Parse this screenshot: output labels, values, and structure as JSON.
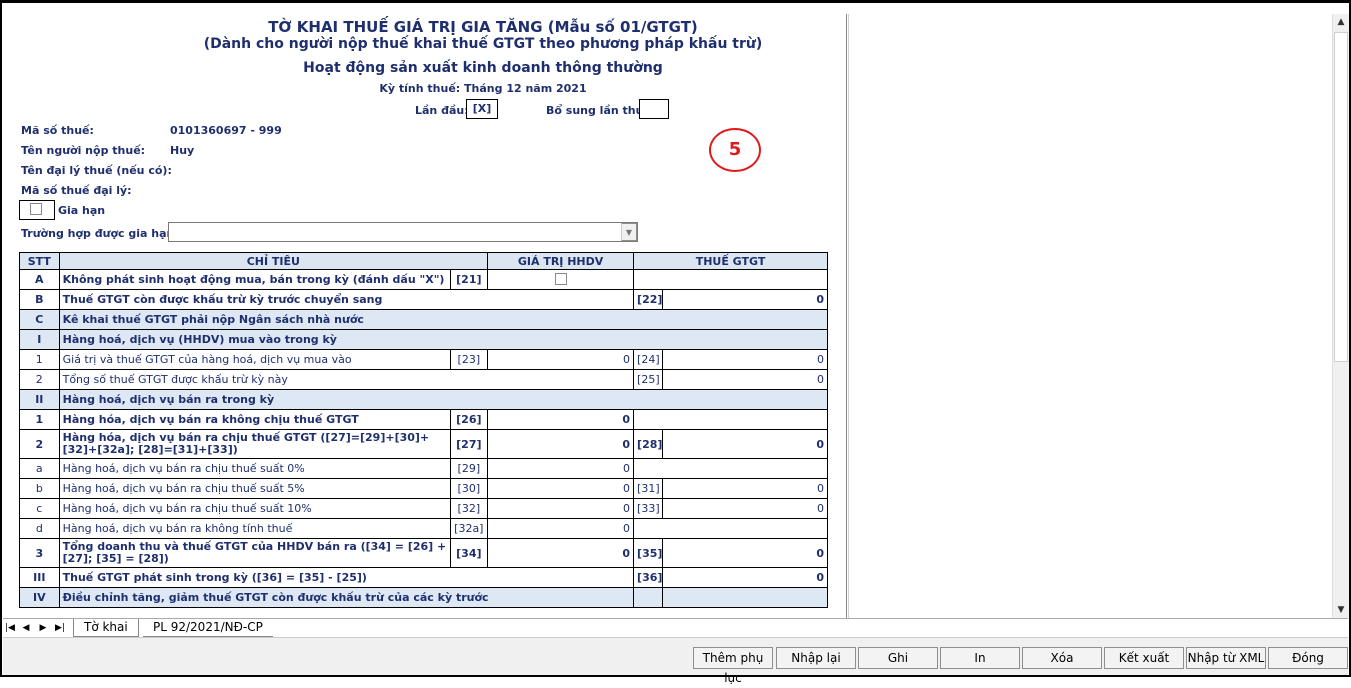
{
  "header": {
    "title": "TỜ KHAI THUẾ GIÁ TRỊ GIA TĂNG (Mẫu số 01/GTGT)",
    "subtitle": "(Dành cho người nộp thuế khai thuế GTGT theo phương pháp khấu trừ)",
    "activity": "Hoạt động sản xuất kinh doanh thông thường",
    "period": "Kỳ tính thuế: Tháng 12 năm 2021",
    "first_time_label": "Lần đầu:",
    "first_time_value": "[X]",
    "supplement_label": "Bổ sung lần thứ:",
    "supplement_value": ""
  },
  "taxpayer": {
    "tax_id_label": "Mã số thuế:",
    "tax_id_value": "0101360697  - 999",
    "name_label": "Tên người nộp thuế:",
    "name_value": "Huy",
    "agent_label": "Tên đại lý thuế (nếu có):",
    "agent_tax_label": "Mã số thuế đại lý:",
    "extension_label": "Gia hạn",
    "extension_case_label": "Trường hợp được gia hạn:",
    "extension_case_value": ""
  },
  "annotation": "5",
  "table": {
    "headers": [
      "STT",
      "CHỈ TIÊU",
      "GIÁ TRỊ HHDV",
      "THUẾ GTGT"
    ],
    "rows": [
      {
        "stt": "A",
        "label": "Không phát sinh hoạt động mua, bán trong kỳ (đánh dấu \"X\")",
        "code1": "[21]",
        "val1": "",
        "code2": "",
        "val2": ""
      },
      {
        "stt": "B",
        "label": "Thuế GTGT còn được khấu trừ kỳ trước chuyển sang",
        "code1": "",
        "val1": "",
        "code2": "[22]",
        "val2": "0"
      },
      {
        "stt": "C",
        "label": "Kê khai thuế GTGT phải nộp Ngân sách nhà nước"
      },
      {
        "stt": "I",
        "label": "Hàng hoá, dịch vụ (HHDV) mua vào trong kỳ"
      },
      {
        "stt": "1",
        "label": "Giá trị và thuế GTGT của hàng hoá, dịch vụ mua vào",
        "code1": "[23]",
        "val1": "0",
        "code2": "[24]",
        "val2": "0"
      },
      {
        "stt": "2",
        "label": "Tổng số thuế GTGT được khấu trừ kỳ này",
        "code1": "",
        "val1": "",
        "code2": "[25]",
        "val2": "0"
      },
      {
        "stt": "II",
        "label": "Hàng hoá, dịch vụ bán ra trong kỳ"
      },
      {
        "stt": "1",
        "label": "Hàng hóa, dịch vụ bán ra không chịu thuế GTGT",
        "code1": "[26]",
        "val1": "0",
        "code2": "",
        "val2": ""
      },
      {
        "stt": "2",
        "label": "Hàng hóa, dịch vụ bán ra chịu thuế GTGT ([27]=[29]+[30]+[32]+[32a]; [28]=[31]+[33])",
        "code1": "[27]",
        "val1": "0",
        "code2": "[28]",
        "val2": "0"
      },
      {
        "stt": "a",
        "label": "Hàng hoá, dịch vụ bán ra chịu thuế suất 0%",
        "code1": "[29]",
        "val1": "0",
        "code2": "",
        "val2": ""
      },
      {
        "stt": "b",
        "label": "Hàng hoá, dịch vụ bán ra chịu thuế suất 5%",
        "code1": "[30]",
        "val1": "0",
        "code2": "[31]",
        "val2": "0"
      },
      {
        "stt": "c",
        "label": "Hàng hoá, dịch vụ bán ra chịu thuế suất 10%",
        "code1": "[32]",
        "val1": "0",
        "code2": "[33]",
        "val2": "0"
      },
      {
        "stt": "d",
        "label": "Hàng hoá, dịch vụ bán ra không tính thuế",
        "code1": "[32a]",
        "val1": "0",
        "code2": "",
        "val2": ""
      },
      {
        "stt": "3",
        "label": "Tổng doanh thu và thuế GTGT của HHDV bán  ra ([34] = [26] + [27]; [35] = [28])",
        "code1": "[34]",
        "val1": "0",
        "code2": "[35]",
        "val2": "0"
      },
      {
        "stt": "III",
        "label": "Thuế GTGT phát sinh trong kỳ ([36] = [35] - [25])",
        "code1": "",
        "val1": "",
        "code2": "[36]",
        "val2": "0"
      },
      {
        "stt": "IV",
        "label": "Điều chỉnh tăng, giảm thuế GTGT còn được khấu trừ của các kỳ trước"
      }
    ]
  },
  "tabs": [
    {
      "label": "Tờ khai"
    },
    {
      "label": "PL 92/2021/NĐ-CP"
    }
  ],
  "buttons": {
    "add_appendix": "Thêm phụ lục",
    "reenter": "Nhập lại",
    "save": "Ghi",
    "print": "In",
    "delete": "Xóa",
    "export": "Kết xuất",
    "import_xml": "Nhập từ XML",
    "close": "Đóng"
  }
}
